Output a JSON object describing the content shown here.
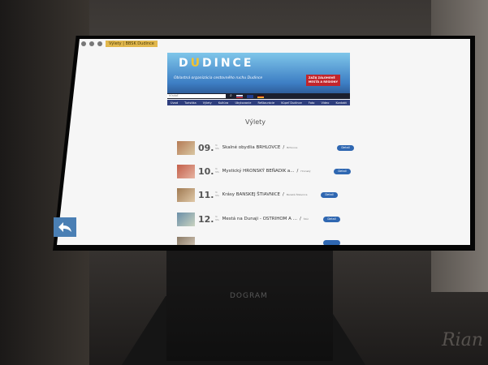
{
  "browser": {
    "url": "Výlety | BBSK Dudince"
  },
  "banner": {
    "logo_left": "D",
    "logo_accent": "U",
    "logo_right": "DINCE",
    "tagline": "Oblastná organizácia cestovného ruchu Dudince",
    "badge_line1": "ZAŽIJ ZÁLOHOVÉ",
    "badge_line2": "MESTÁ A REGIÓNY"
  },
  "search": {
    "placeholder": "hľadať",
    "icon": "search-icon",
    "lang_sk": "sk",
    "lang_en": "en",
    "lang_de": "de"
  },
  "nav": [
    "Úvod",
    "Turistika",
    "Výlety",
    "Kultúra",
    "Ubytovanie",
    "Reštaurácie",
    "Kúpeľ Dudince",
    "Foto",
    "Video",
    "Kontakt"
  ],
  "page_title": "Výlety",
  "trips": [
    {
      "number": "09.",
      "tag_top": "ti",
      "tag_bottom": "tm",
      "name": "Skalné obydlia BRHLOVCE",
      "sep": "/",
      "location": "Brhlovce",
      "button": "Detail"
    },
    {
      "number": "10.",
      "tag_top": "ti",
      "tag_bottom": "tm",
      "name": "Mystický HRONSKÝ BEŇADIK a...",
      "sep": "/",
      "location": "Hronský",
      "button": "Detail"
    },
    {
      "number": "11.",
      "tag_top": "ti",
      "tag_bottom": "tm",
      "name": "Krásy BANSKEJ ŠTIAVNICE",
      "sep": "/",
      "location": "Banská Štiavnica",
      "button": "Detail"
    },
    {
      "number": "12.",
      "tag_top": "ti",
      "tag_bottom": "tm",
      "name": "Mestá na Dunaji - OSTRIHOM A ...",
      "sep": "/",
      "location": "Štúr",
      "button": "Detail"
    }
  ],
  "back_button": {
    "icon": "back-arrow-icon"
  },
  "kiosk": {
    "stand_label": "DOGRAM",
    "floor_logo": "Rian"
  },
  "colors": {
    "accent": "#2f67b1",
    "nav_bg": "#2f3f7e",
    "url_bar": "#e2b84d"
  }
}
